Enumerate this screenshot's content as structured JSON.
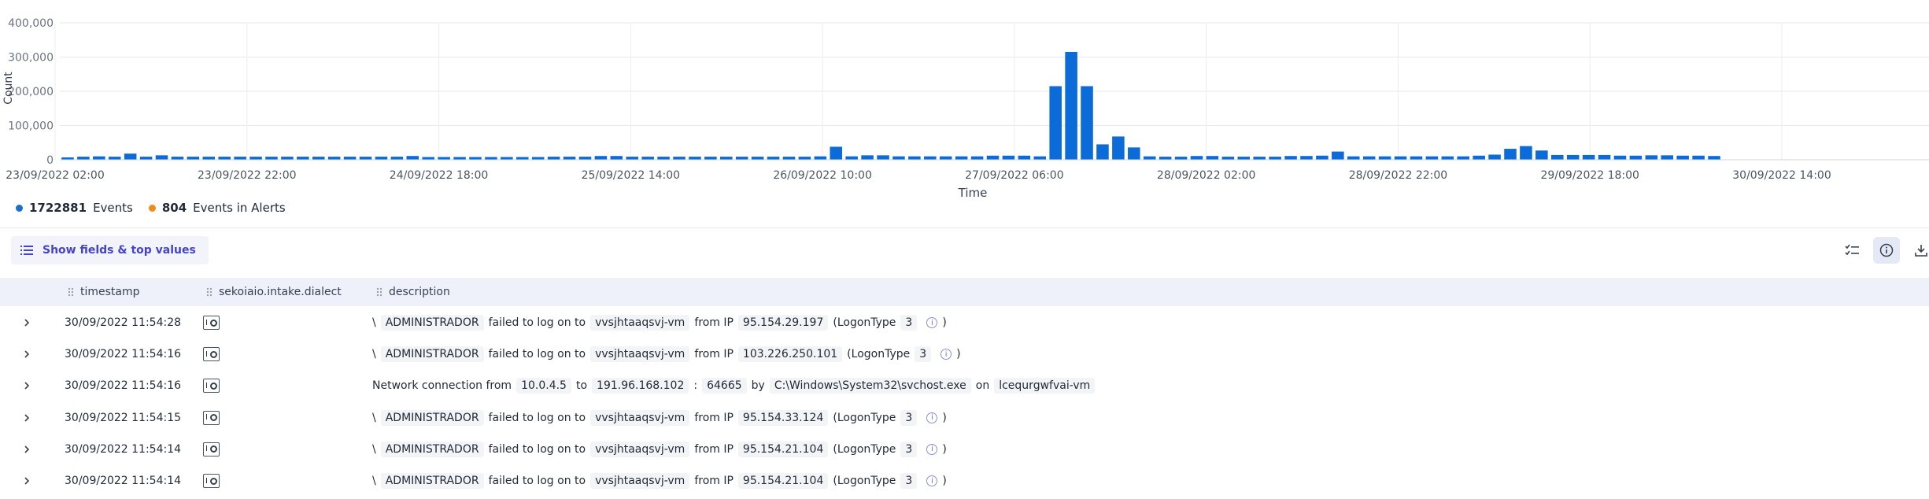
{
  "chart_data": {
    "type": "bar",
    "ylabel": "Count",
    "xlabel": "Time",
    "ylim": [
      0,
      400000
    ],
    "yticks": [
      0,
      100000,
      200000,
      300000,
      400000
    ],
    "ytick_labels": [
      "0",
      "100,000",
      "200,000",
      "300,000",
      "400,000"
    ],
    "xtick_labels": [
      "23/09/2022 02:00",
      "23/09/2022 22:00",
      "24/09/2022 18:00",
      "25/09/2022 14:00",
      "26/09/2022 10:00",
      "27/09/2022 06:00",
      "28/09/2022 02:00",
      "28/09/2022 22:00",
      "29/09/2022 18:00",
      "30/09/2022 14:00"
    ],
    "bar_color": "#0b6bd8",
    "grid": true,
    "interval_hours": 2,
    "values": [
      7000,
      9000,
      10000,
      9000,
      18000,
      9000,
      13000,
      9000,
      9000,
      9000,
      9000,
      9000,
      9000,
      9000,
      9000,
      9000,
      9000,
      9000,
      9000,
      9000,
      9000,
      9000,
      11000,
      8000,
      8000,
      8000,
      8000,
      8000,
      8000,
      8000,
      8000,
      9000,
      9000,
      9000,
      11000,
      11000,
      9000,
      9000,
      9000,
      9000,
      9000,
      9000,
      9000,
      9000,
      9000,
      9000,
      9000,
      9000,
      10000,
      38000,
      10000,
      13000,
      13000,
      10000,
      10000,
      10000,
      10000,
      10000,
      10000,
      12000,
      12000,
      12000,
      10000,
      215000,
      315000,
      215000,
      45000,
      68000,
      36000,
      10000,
      9000,
      9000,
      11000,
      11000,
      9000,
      9000,
      9000,
      9000,
      11000,
      11000,
      12000,
      24000,
      10000,
      10000,
      10000,
      10000,
      10000,
      10000,
      10000,
      10000,
      12000,
      15000,
      32000,
      40000,
      27000,
      14000,
      14000,
      14000,
      14000,
      12000,
      12000,
      13000,
      13000,
      12000,
      12000,
      11000,
      500,
      500,
      500,
      500,
      500,
      500,
      500,
      500,
      500,
      500,
      500,
      500,
      500
    ]
  },
  "legend": [
    {
      "color": "#1a6fcf",
      "count": "1722881",
      "label": "Events"
    },
    {
      "color": "#f08c1a",
      "count": "804",
      "label": "Events in Alerts"
    }
  ],
  "toolbar": {
    "fields_button": "Show fields & top values"
  },
  "table": {
    "columns": [
      "timestamp",
      "sekoiaio.intake.dialect",
      "description"
    ],
    "rows": [
      {
        "timestamp": "30/09/2022 11:54:28",
        "kind": "logon",
        "user": "ADMINISTRADOR",
        "host": "vvsjhtaaqsvj-vm",
        "ip": "95.154.29.197",
        "logontype": "3"
      },
      {
        "timestamp": "30/09/2022 11:54:16",
        "kind": "logon",
        "user": "ADMINISTRADOR",
        "host": "vvsjhtaaqsvj-vm",
        "ip": "103.226.250.101",
        "logontype": "3"
      },
      {
        "timestamp": "30/09/2022 11:54:16",
        "kind": "network",
        "src": "10.0.4.5",
        "dst": "191.96.168.102",
        "port": "64665",
        "proc": "C:\\Windows\\System32\\svchost.exe",
        "host": "lcequrgwfvai-vm"
      },
      {
        "timestamp": "30/09/2022 11:54:15",
        "kind": "logon",
        "user": "ADMINISTRADOR",
        "host": "vvsjhtaaqsvj-vm",
        "ip": "95.154.33.124",
        "logontype": "3"
      },
      {
        "timestamp": "30/09/2022 11:54:14",
        "kind": "logon",
        "user": "ADMINISTRADOR",
        "host": "vvsjhtaaqsvj-vm",
        "ip": "95.154.21.104",
        "logontype": "3"
      },
      {
        "timestamp": "30/09/2022 11:54:14",
        "kind": "logon",
        "user": "ADMINISTRADOR",
        "host": "vvsjhtaaqsvj-vm",
        "ip": "95.154.21.104",
        "logontype": "3"
      }
    ],
    "phrases": {
      "backslash": "\\",
      "failed": "failed to log on to",
      "from_ip": "from IP",
      "logon_open": "(LogonType",
      "close": ")",
      "net_from": "Network connection from",
      "to": "to",
      "colon": ":",
      "by": "by",
      "on": "on"
    }
  }
}
